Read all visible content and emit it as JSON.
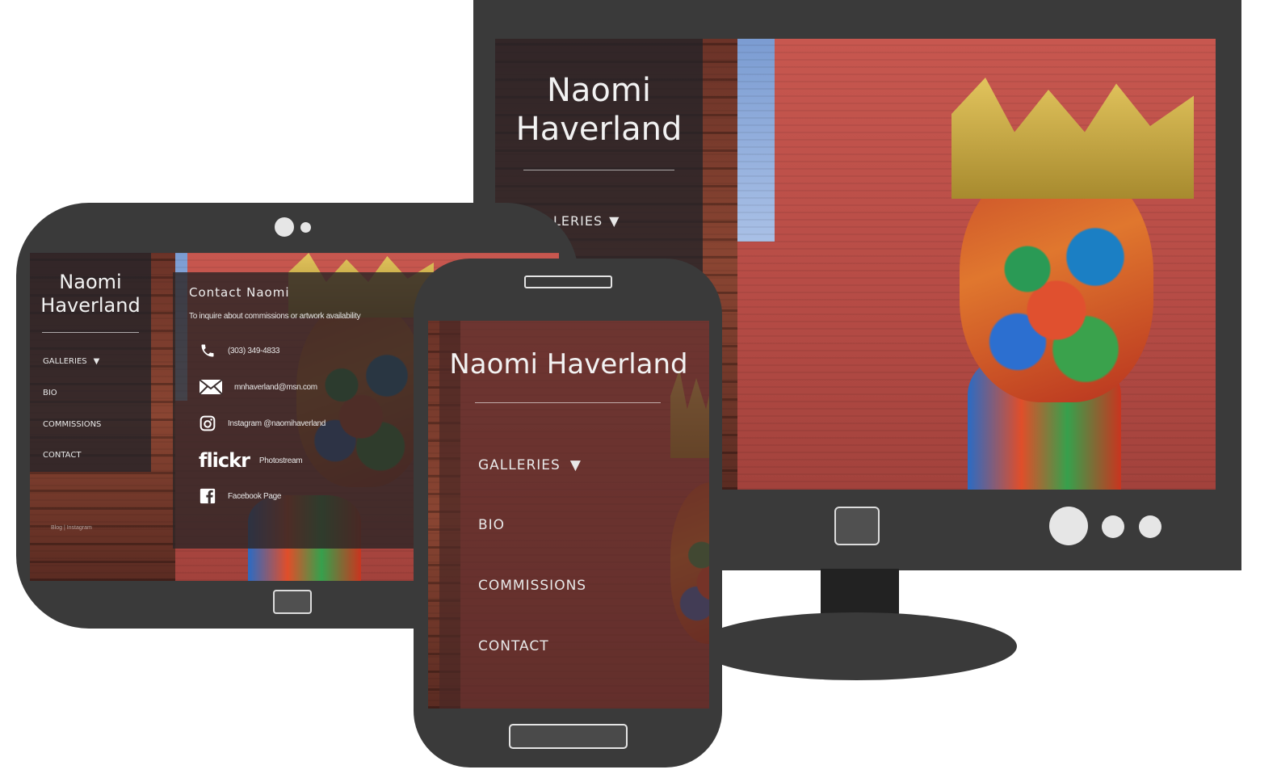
{
  "site": {
    "name_line1": "Naomi",
    "name_line2": "Haverland",
    "name_full": "Naomi Haverland"
  },
  "monitor": {
    "nav": {
      "galleries_label": "LERIES"
    }
  },
  "nav": {
    "galleries": "GALLERIES",
    "bio": "BIO",
    "commissions": "COMMISSIONS",
    "contact": "CONTACT",
    "caret": "▼"
  },
  "tablet": {
    "footer_text": "Blog | Instagram"
  },
  "contact": {
    "heading": "Contact Naomi",
    "intro": "To inquire about commissions or artwork availability",
    "phone": "(303) 349-4833",
    "email": "mnhaverland@msn.com",
    "instagram": "Instagram @naomihaverland",
    "flickr_logo": "flickr",
    "flickr": "Photostream",
    "facebook": "Facebook Page"
  },
  "icons": {
    "phone": "phone-icon",
    "email": "envelope-icon",
    "instagram": "instagram-icon",
    "facebook": "facebook-icon"
  },
  "colors": {
    "device_body": "#3a3a3a",
    "panel_overlay": "#232328",
    "mural_wall": "#b54b45"
  }
}
